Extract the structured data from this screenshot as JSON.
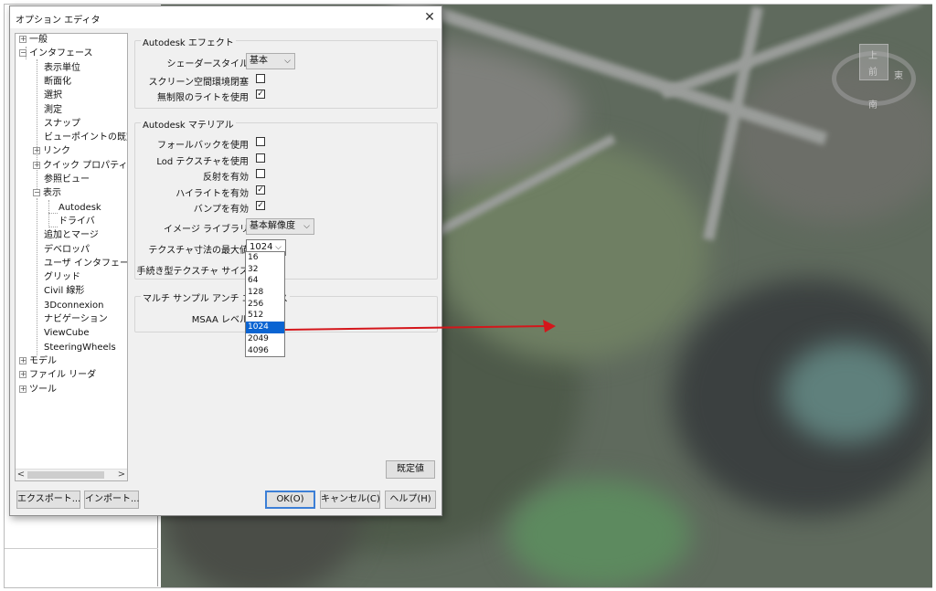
{
  "dialog": {
    "title": "オプション エディタ",
    "close_glyph": "✕"
  },
  "tree": {
    "items": [
      {
        "label": "一般",
        "expander": "+"
      },
      {
        "label": "インタフェース",
        "expander": "−"
      },
      {
        "label": "表示単位"
      },
      {
        "label": "断面化"
      },
      {
        "label": "選択"
      },
      {
        "label": "測定"
      },
      {
        "label": "スナップ"
      },
      {
        "label": "ビューポイントの既定"
      },
      {
        "label": "リンク",
        "expander": "+"
      },
      {
        "label": "クイック プロパティ",
        "expander": "+"
      },
      {
        "label": "参照ビュー"
      },
      {
        "label": "表示",
        "expander": "−"
      },
      {
        "label": "Autodesk"
      },
      {
        "label": "ドライバ"
      },
      {
        "label": "追加とマージ"
      },
      {
        "label": "デベロッパ"
      },
      {
        "label": "ユーザ インタフェース"
      },
      {
        "label": "グリッド"
      },
      {
        "label": "Civil 線形"
      },
      {
        "label": "3Dconnexion"
      },
      {
        "label": "ナビゲーション"
      },
      {
        "label": "ViewCube"
      },
      {
        "label": "SteeringWheels"
      },
      {
        "label": "モデル",
        "expander": "+"
      },
      {
        "label": "ファイル リーダ",
        "expander": "+"
      },
      {
        "label": "ツール",
        "expander": "+"
      }
    ],
    "scroll_left": "<",
    "scroll_right": ">"
  },
  "effects": {
    "title": "Autodesk エフェクト",
    "shader_label": "シェーダースタイル",
    "shader_value": "基本",
    "ssao_label": "スクリーン空間環境閉塞",
    "ssao_checked": false,
    "unlimited_lights_label": "無制限のライトを使用",
    "unlimited_lights_checked": true
  },
  "materials": {
    "title": "Autodesk マテリアル",
    "fallback_label": "フォールバックを使用",
    "fallback_checked": false,
    "lod_label": "Lod テクスチャを使用",
    "lod_checked": false,
    "reflection_label": "反射を有効",
    "reflection_checked": false,
    "highlight_label": "ハイライトを有効",
    "highlight_checked": true,
    "bump_label": "バンプを有効",
    "bump_checked": true,
    "image_library_label": "イメージ ライブラリ",
    "image_library_value": "基本解像度",
    "texture_max_label": "テクスチャ寸法の最大値",
    "texture_max_value": "1024",
    "procedural_label": "手続き型テクスチャ サイズ",
    "texture_options": [
      "16",
      "32",
      "64",
      "128",
      "256",
      "512",
      "1024",
      "2049",
      "4096"
    ],
    "texture_selected_index": 6
  },
  "msaa": {
    "title": "マルチ サンプル アンチ エイリアス",
    "level_label": "MSAA レベル"
  },
  "buttons": {
    "defaults": "既定値",
    "export": "エクスポート...",
    "import": "インポート...",
    "ok": "OK(O)",
    "cancel": "キャンセル(C)",
    "help": "ヘルプ(H)"
  },
  "viewcube": {
    "top": "上",
    "front": "前",
    "south": "南",
    "east": "東"
  },
  "glyphs": {
    "check": "✓",
    "caret": "⌵"
  },
  "colors": {
    "selection_blue": "#0a64d2",
    "arrow_red": "#d4161b"
  }
}
